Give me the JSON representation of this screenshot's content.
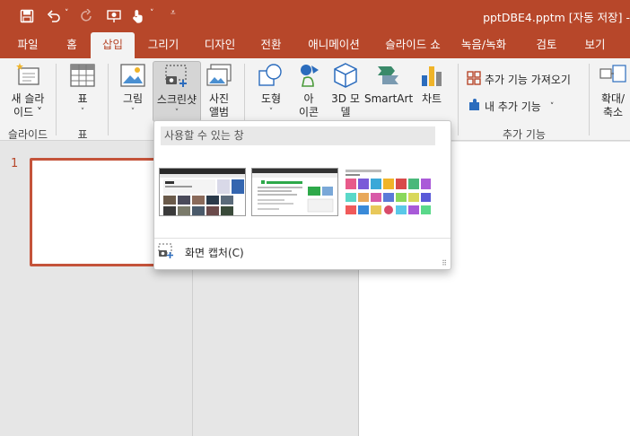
{
  "window": {
    "title": "pptDBE4.pptm [자동 저장] -"
  },
  "quick_access": {
    "save_icon": "save-icon",
    "undo_icon": "undo-icon",
    "redo_icon": "redo-icon",
    "present_icon": "present-from-start-icon",
    "touch_icon": "touch-mode-icon",
    "customize_icon": "customize-qat-icon"
  },
  "tabs": [
    {
      "label": "파일"
    },
    {
      "label": "홈"
    },
    {
      "label": "삽입"
    },
    {
      "label": "그리기"
    },
    {
      "label": "디자인"
    },
    {
      "label": "전환"
    },
    {
      "label": "애니메이션"
    },
    {
      "label": "슬라이드 쇼"
    },
    {
      "label": "녹음/녹화"
    },
    {
      "label": "검토"
    },
    {
      "label": "보기"
    }
  ],
  "ribbon": {
    "new_slide": {
      "line1": "새 슬라",
      "line2": "이드 ˅",
      "group": "슬라이드"
    },
    "table": {
      "label": "표",
      "group": "표"
    },
    "picture": {
      "label": "그림"
    },
    "screenshot": {
      "label": "스크린샷"
    },
    "album": {
      "line1": "사진",
      "line2": "앨범"
    },
    "shapes": {
      "label": "도형"
    },
    "icons": {
      "line1": "아",
      "line2": "이콘"
    },
    "model3d": {
      "line1": "3D 모",
      "line2": "델"
    },
    "smartart": {
      "label": "SmartArt"
    },
    "chart": {
      "label": "차트"
    },
    "get_addins": {
      "label": "추가 기능 가져오기"
    },
    "my_addins": {
      "label": "내 추가 기능"
    },
    "addins_group": "추가 기능",
    "zoom": {
      "line1": "확대/",
      "line2": "축소"
    }
  },
  "slides": {
    "current": "1"
  },
  "screenshot_menu": {
    "header": "사용할 수 있는 창",
    "windows": [
      "window-thumbnail-1",
      "window-thumbnail-2",
      "window-thumbnail-3"
    ],
    "capture_label": "화면 캡처(C)"
  },
  "colors": {
    "accent": "#b7472a",
    "ribbon_bg": "#f3f3f3",
    "pane_bg": "#e6e6e6"
  }
}
